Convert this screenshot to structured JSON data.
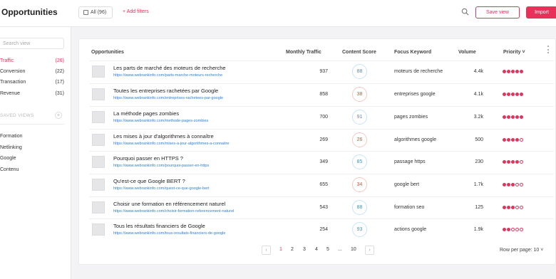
{
  "header": {
    "title": "Opportunities",
    "filter_chip": "All (96)",
    "add_filters": "+ Add filters",
    "save_view": "Save view",
    "import": "Import"
  },
  "sidebar": {
    "search_placeholder": "Search view",
    "categories": [
      {
        "label": "Traffic",
        "count": "(26)",
        "active": true
      },
      {
        "label": "Conversion",
        "count": "(22)",
        "active": false
      },
      {
        "label": "Transaction",
        "count": "(17)",
        "active": false
      },
      {
        "label": "Revenue",
        "count": "(31)",
        "active": false
      }
    ],
    "saved_views_label": "SAVED VIEWS",
    "saved_views_add": "+",
    "views": [
      "Formation",
      "Netlinking",
      "Google",
      "Contenu"
    ]
  },
  "table": {
    "headers": {
      "opportunities": "Opportunities",
      "traffic": "Monthly Traffic",
      "score": "Content Score",
      "keyword": "Focus Keyword",
      "volume": "Volume",
      "priority": "Priority ˅"
    },
    "rows": [
      {
        "title": "Les parts de marché des moteurs de recherche",
        "url": "https://www.webrankinfo.com/parts-marche-moteurs-recherche",
        "traffic": "937",
        "score": "88",
        "score_status": "good",
        "keyword": "moteurs de recherche",
        "volume": "4.4k",
        "priority": 5
      },
      {
        "title": "Toutes les entreprises rachetées par Google",
        "url": "https://www.webrankinfo.com/entreprises-rachetees-par-google",
        "traffic": "858",
        "score": "38",
        "score_status": "bad",
        "keyword": "entreprises google",
        "volume": "4.1k",
        "priority": 5
      },
      {
        "title": "La méthode pages zombies",
        "url": "https://www.webrankinfo.com/methode-pages-zombies",
        "traffic": "700",
        "score": "91",
        "score_status": "good",
        "keyword": "pages zombies",
        "volume": "3.2k",
        "priority": 5
      },
      {
        "title": "Les mises à jour d'algorithmes à connaître",
        "url": "https://www.webrankinfo.com/mises-a-jour-algorithmes-a-connaitre",
        "traffic": "269",
        "score": "26",
        "score_status": "bad",
        "keyword": "algorithmes google",
        "volume": "500",
        "priority": 4
      },
      {
        "title": "Pourquoi passer en HTTPS ?",
        "url": "https://www.webrankinfo.com/pourquoi-passer-en-https",
        "traffic": "349",
        "score": "85",
        "score_status": "good",
        "keyword": "passage https",
        "volume": "230",
        "priority": 4
      },
      {
        "title": "Qu'est-ce que Google BERT ?",
        "url": "https://www.webrankinfo.com/quest-ce-que-google-bert",
        "traffic": "655",
        "score": "34",
        "score_status": "bad",
        "keyword": "google bert",
        "volume": "1.7k",
        "priority": 3
      },
      {
        "title": "Choisir une formation en référencement naturel",
        "url": "https://www.webrankinfo.com/choisir-formation-referencement-naturel",
        "traffic": "543",
        "score": "88",
        "score_status": "good",
        "keyword": "formation seo",
        "volume": "125",
        "priority": 3
      },
      {
        "title": "Tous les résultats financiers de Google",
        "url": "https://www.webrankinfo.com/tous-resultats-financiers-de-google",
        "traffic": "254",
        "score": "93",
        "score_status": "good",
        "keyword": "actions google",
        "volume": "1.9k",
        "priority": 2
      }
    ]
  },
  "pagination": {
    "prev": "‹",
    "pages": [
      "1",
      "2",
      "3",
      "4",
      "5",
      "...",
      "10"
    ],
    "current": "1",
    "next": "›",
    "rows_per_page": "Row per page: 10 ˅"
  },
  "colors": {
    "accent": "#e8315a",
    "link": "#2f7fd1",
    "score_good": "#3a9ad6",
    "score_bad": "#e24f3b"
  }
}
